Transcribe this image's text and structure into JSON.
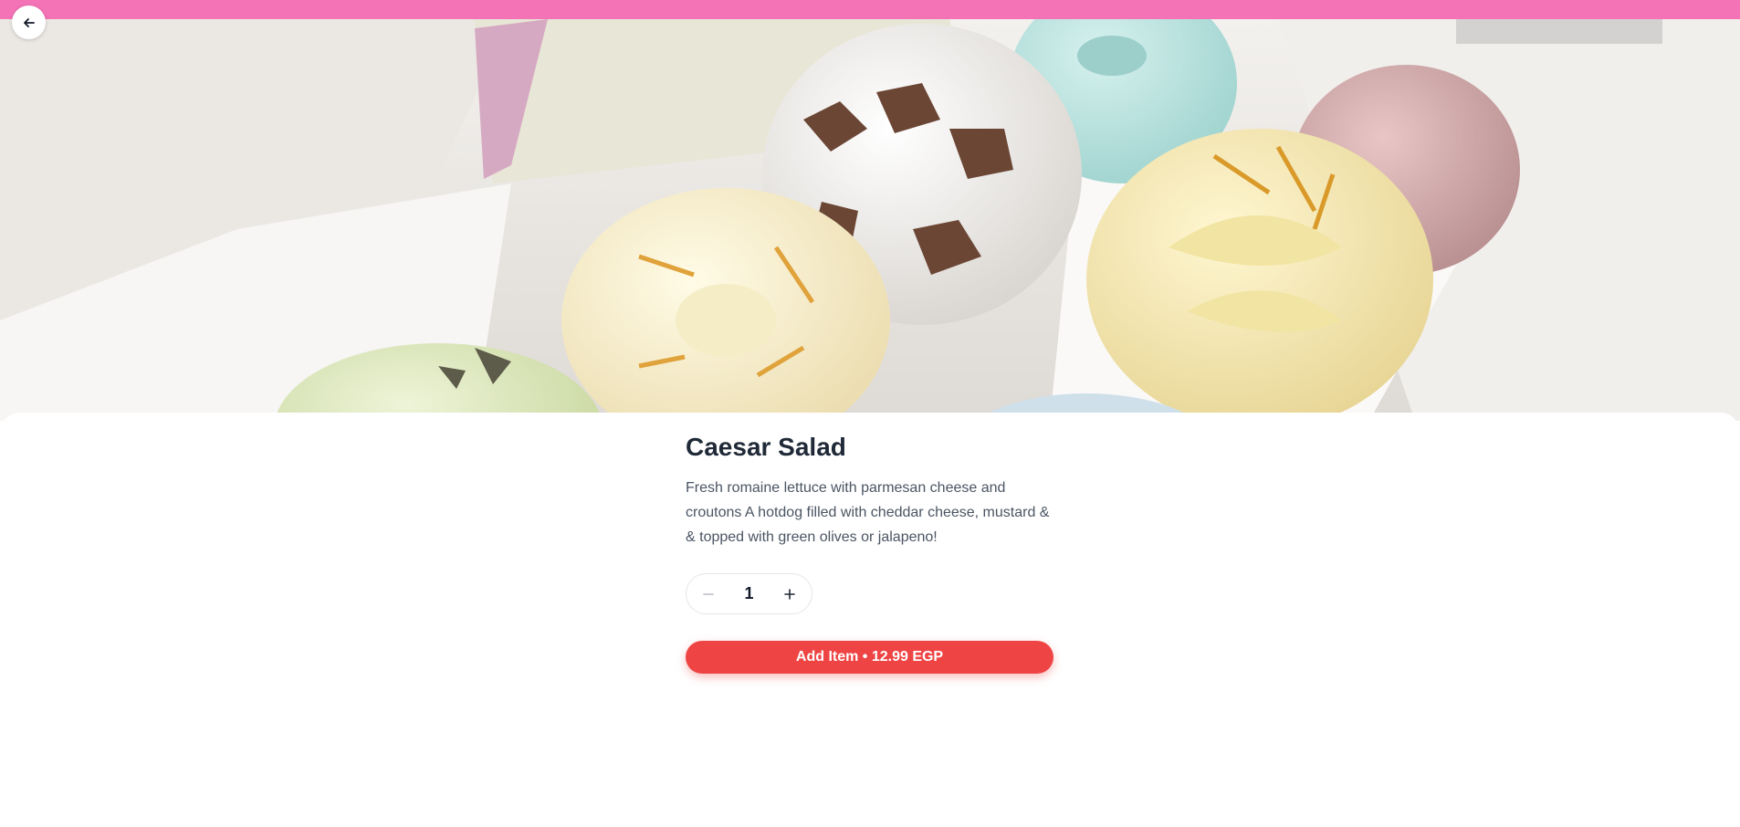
{
  "header": {
    "back_icon": "arrow-left-icon",
    "accent_color": "#f472b6"
  },
  "hero": {
    "image_subject": "bath bombs in a gift box"
  },
  "product": {
    "name": "Caesar Salad",
    "description": "Fresh romaine lettuce with parmesan cheese and croutons A hotdog filled with cheddar cheese, mustard & & topped with green olives or jalapeno!",
    "quantity": "1",
    "minus_icon": "minus-icon",
    "plus_icon": "plus-icon"
  },
  "cart": {
    "add_button_label": "Add Item • 12.99 EGP",
    "button_color": "#ef4444"
  }
}
